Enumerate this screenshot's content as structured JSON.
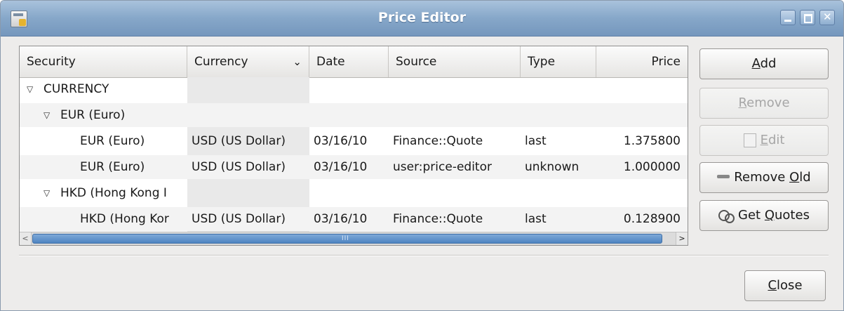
{
  "window": {
    "title": "Price Editor",
    "controls": {
      "minimize": "minimize",
      "maximize": "maximize",
      "close": "close"
    }
  },
  "table": {
    "columns": [
      {
        "label": "Security"
      },
      {
        "label": "Currency",
        "sort_indicator": "⌄"
      },
      {
        "label": "Date"
      },
      {
        "label": "Source"
      },
      {
        "label": "Type"
      },
      {
        "label": "Price"
      }
    ],
    "rows": [
      {
        "level": 0,
        "expanded": true,
        "security": "CURRENCY",
        "currency": "",
        "date": "",
        "source": "",
        "type": "",
        "price": ""
      },
      {
        "level": 1,
        "expanded": true,
        "security": "EUR (Euro)",
        "currency": "",
        "date": "",
        "source": "",
        "type": "",
        "price": ""
      },
      {
        "level": 2,
        "security": "EUR (Euro)",
        "currency": "USD (US Dollar)",
        "date": "03/16/10",
        "source": "Finance::Quote",
        "type": "last",
        "price": "1.375800"
      },
      {
        "level": 2,
        "security": "EUR (Euro)",
        "currency": "USD (US Dollar)",
        "date": "03/16/10",
        "source": "user:price-editor",
        "type": "unknown",
        "price": "1.000000"
      },
      {
        "level": 1,
        "expanded": true,
        "security": "HKD (Hong Kong I",
        "currency": "",
        "date": "",
        "source": "",
        "type": "",
        "price": ""
      },
      {
        "level": 2,
        "security": "HKD (Hong Kor",
        "currency": "USD (US Dollar)",
        "date": "03/16/10",
        "source": "Finance::Quote",
        "type": "last",
        "price": "0.128900"
      }
    ],
    "scrollbar": {
      "grip": "III"
    }
  },
  "buttons": {
    "add": {
      "label_mnemonic": "A",
      "label_rest": "dd"
    },
    "remove": {
      "label_mnemonic": "R",
      "label_rest": "emove"
    },
    "edit": {
      "label_mnemonic": "E",
      "label_rest": "dit"
    },
    "remove_old": {
      "label_pre": "Remove ",
      "label_mnemonic": "O",
      "label_rest": "ld"
    },
    "get_quotes": {
      "label_pre": "Get ",
      "label_mnemonic": "Q",
      "label_rest": "uotes"
    },
    "close": {
      "label_mnemonic": "C",
      "label_rest": "lose"
    }
  },
  "icons": {
    "expander": "▽"
  },
  "colors": {
    "titlebar": "#86a7c9",
    "scroll_thumb": "#4f84c1",
    "disabled_text": "#a6a6a6"
  }
}
